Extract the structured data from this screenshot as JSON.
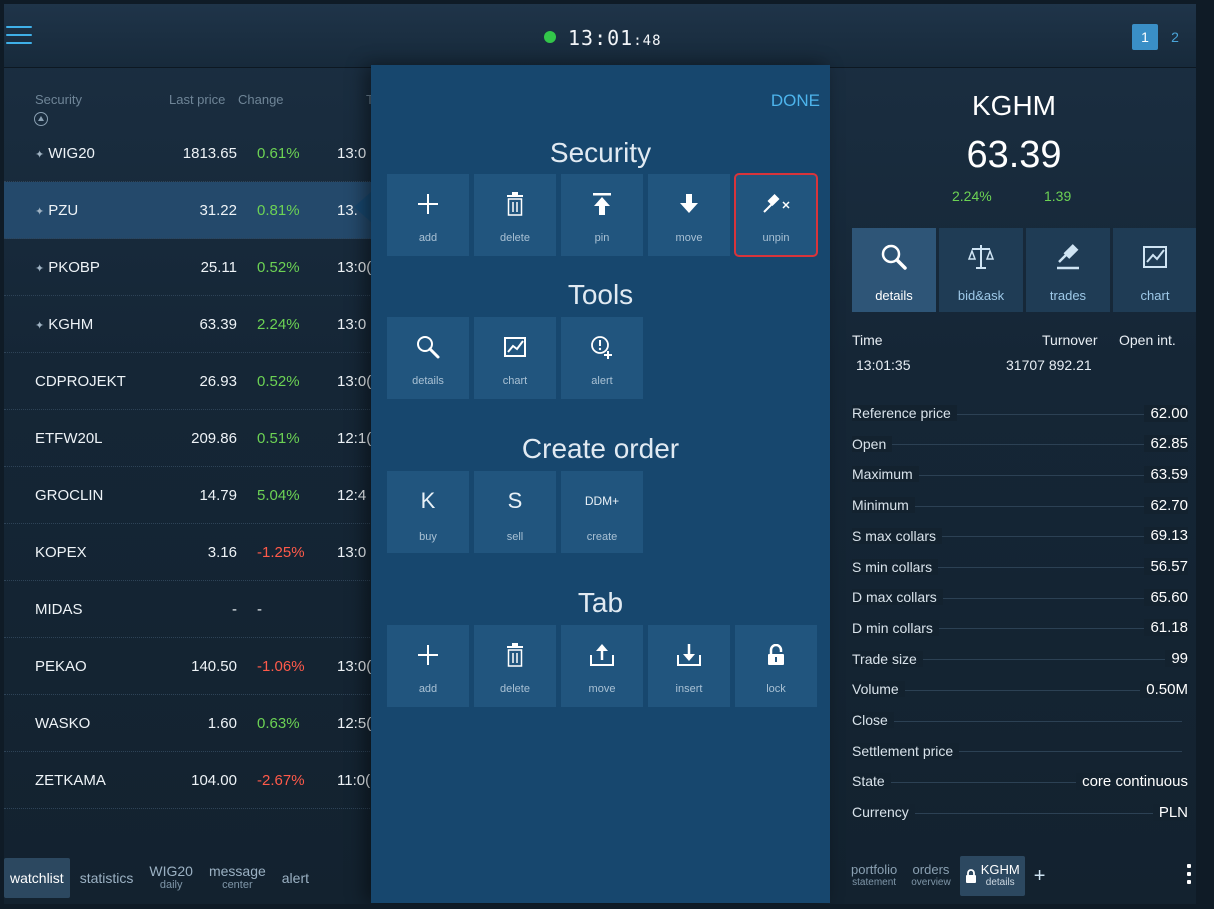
{
  "clock": {
    "hm": "13:01",
    "sec": ":48"
  },
  "pages": [
    "1",
    "2"
  ],
  "watchlist": {
    "headers": {
      "security": "Security",
      "last_price": "Last price",
      "change": "Change",
      "time": "T"
    },
    "rows": [
      {
        "name": "WIG20",
        "pinned": true,
        "price": "1813.65",
        "change": "0.61%",
        "dir": "pos",
        "time": "13:0"
      },
      {
        "name": "PZU",
        "pinned": true,
        "price": "31.22",
        "change": "0.81%",
        "dir": "pos",
        "time": "13."
      },
      {
        "name": "PKOBP",
        "pinned": true,
        "price": "25.11",
        "change": "0.52%",
        "dir": "pos",
        "time": "13:0("
      },
      {
        "name": "KGHM",
        "pinned": true,
        "price": "63.39",
        "change": "2.24%",
        "dir": "pos",
        "time": "13:0"
      },
      {
        "name": "CDPROJEKT",
        "pinned": false,
        "price": "26.93",
        "change": "0.52%",
        "dir": "pos",
        "time": "13:0("
      },
      {
        "name": "ETFW20L",
        "pinned": false,
        "price": "209.86",
        "change": "0.51%",
        "dir": "pos",
        "time": "12:1("
      },
      {
        "name": "GROCLIN",
        "pinned": false,
        "price": "14.79",
        "change": "5.04%",
        "dir": "pos",
        "time": "12:4"
      },
      {
        "name": "KOPEX",
        "pinned": false,
        "price": "3.16",
        "change": "-1.25%",
        "dir": "neg",
        "time": "13:0"
      },
      {
        "name": "MIDAS",
        "pinned": false,
        "price": "-",
        "change": "-",
        "dir": "neu",
        "time": ""
      },
      {
        "name": "PEKAO",
        "pinned": false,
        "price": "140.50",
        "change": "-1.06%",
        "dir": "neg",
        "time": "13:0("
      },
      {
        "name": "WASKO",
        "pinned": false,
        "price": "1.60",
        "change": "0.63%",
        "dir": "pos",
        "time": "12:5("
      },
      {
        "name": "ZETKAMA",
        "pinned": false,
        "price": "104.00",
        "change": "-2.67%",
        "dir": "neg",
        "time": "11:0("
      }
    ]
  },
  "bottom_tabs": [
    {
      "label": "watchlist",
      "sub": ""
    },
    {
      "label": "statistics",
      "sub": ""
    },
    {
      "label": "WIG20",
      "sub": "daily"
    },
    {
      "label": "message",
      "sub": "center"
    },
    {
      "label": "alert",
      "sub": ""
    }
  ],
  "popup": {
    "done": "DONE",
    "sections": {
      "security": {
        "title": "Security",
        "items": [
          "add",
          "delete",
          "pin",
          "move",
          "unpin"
        ]
      },
      "tools": {
        "title": "Tools",
        "items": [
          "details",
          "chart",
          "alert"
        ]
      },
      "order": {
        "title": "Create order",
        "items": [
          {
            "glyph": "K",
            "label": "buy"
          },
          {
            "glyph": "S",
            "label": "sell"
          },
          {
            "glyph": "DDM+",
            "label": "create"
          }
        ]
      },
      "tab": {
        "title": "Tab",
        "items": [
          "add",
          "delete",
          "move",
          "insert",
          "lock"
        ]
      }
    }
  },
  "detail": {
    "symbol": "KGHM",
    "price": "63.39",
    "change_pct": "2.24%",
    "change_abs": "1.39",
    "tabs": [
      "details",
      "bid&ask",
      "trades",
      "chart"
    ],
    "time_label": "Time",
    "time_value": "13:01:35",
    "turnover_label": "Turnover",
    "turnover_value": "31707 892.21",
    "openint_label": "Open int.",
    "fields": [
      {
        "k": "Reference price",
        "v": "62.00"
      },
      {
        "k": "Open",
        "v": "62.85"
      },
      {
        "k": "Maximum",
        "v": "63.59"
      },
      {
        "k": "Minimum",
        "v": "62.70"
      },
      {
        "k": "S max collars",
        "v": "69.13"
      },
      {
        "k": "S min collars",
        "v": "56.57"
      },
      {
        "k": "D max collars",
        "v": "65.60"
      },
      {
        "k": "D min collars",
        "v": "61.18"
      },
      {
        "k": "Trade size",
        "v": "99"
      },
      {
        "k": "Volume",
        "v": "0.50M"
      },
      {
        "k": "Close",
        "v": ""
      },
      {
        "k": "Settlement price",
        "v": ""
      },
      {
        "k": "State",
        "v": "core continuous"
      },
      {
        "k": "Currency",
        "v": "PLN"
      }
    ],
    "bottom_tabs": [
      {
        "label": "portfolio",
        "sub": "statement"
      },
      {
        "label": "orders",
        "sub": "overview"
      },
      {
        "label": "KGHM",
        "sub": "details"
      }
    ],
    "plus": "+"
  }
}
